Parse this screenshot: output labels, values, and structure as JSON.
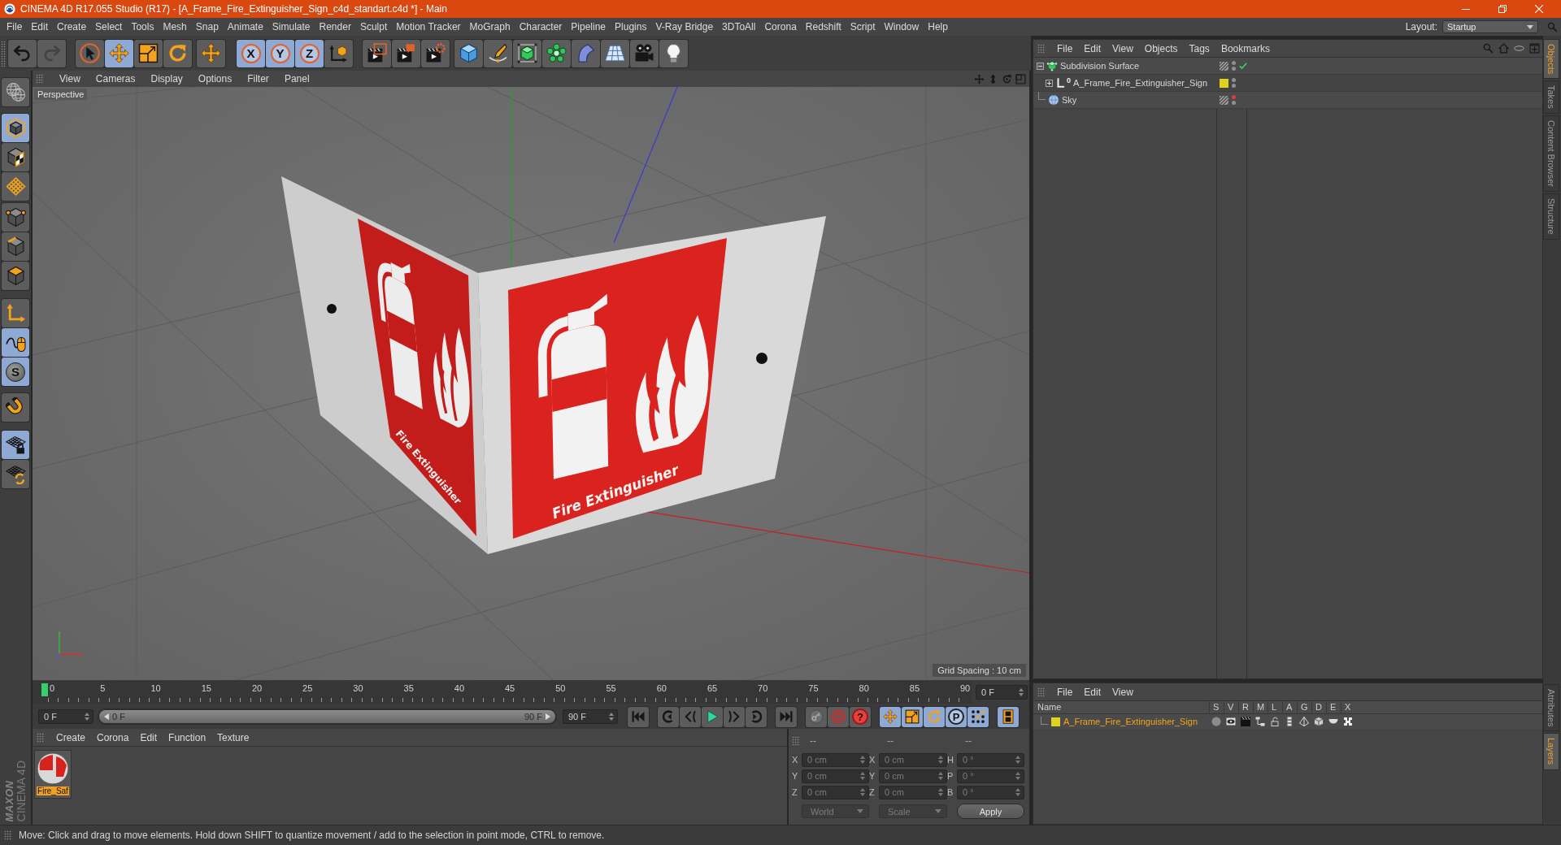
{
  "window": {
    "title": "CINEMA 4D R17.055 Studio (R17) - [A_Frame_Fire_Extinguisher_Sign_c4d_standart.c4d *] - Main"
  },
  "menu_bar": {
    "items": [
      "File",
      "Edit",
      "Create",
      "Select",
      "Tools",
      "Mesh",
      "Snap",
      "Animate",
      "Simulate",
      "Render",
      "Sculpt",
      "Motion Tracker",
      "MoGraph",
      "Character",
      "Pipeline",
      "Plugins",
      "V-Ray Bridge",
      "3DToAll",
      "Corona",
      "Redshift",
      "Script",
      "Window",
      "Help"
    ],
    "layout": {
      "label": "Layout:",
      "value": "Startup"
    }
  },
  "toolbar": {
    "history": [
      {
        "kind": "undo",
        "disabled": false
      },
      {
        "kind": "redo",
        "disabled": true
      }
    ],
    "groups": [
      [
        {
          "kind": "select",
          "selected": false
        },
        {
          "kind": "move",
          "selected": true
        },
        {
          "kind": "scale",
          "selected": false
        },
        {
          "kind": "rotate",
          "selected": false
        }
      ],
      [
        {
          "kind": "move",
          "selected": false
        }
      ],
      [
        {
          "kind": "axis",
          "label": "X",
          "selected": true
        },
        {
          "kind": "axis",
          "label": "Y",
          "selected": true
        },
        {
          "kind": "axis",
          "label": "Z",
          "selected": true
        },
        {
          "kind": "coords",
          "selected": false
        }
      ],
      [
        {
          "kind": "render-view",
          "selected": false
        },
        {
          "kind": "render-picture",
          "selected": false
        },
        {
          "kind": "render-settings",
          "selected": false
        }
      ],
      [
        {
          "kind": "cube",
          "selected": false
        },
        {
          "kind": "pen",
          "selected": false
        },
        {
          "kind": "subdivision",
          "selected": false
        },
        {
          "kind": "cloner",
          "selected": false
        },
        {
          "kind": "deformer",
          "selected": false
        },
        {
          "kind": "floor",
          "selected": false
        },
        {
          "kind": "camera",
          "selected": false
        },
        {
          "kind": "light",
          "selected": false
        }
      ]
    ]
  },
  "left_toolbar": {
    "groups": [
      [
        {
          "kind": "globe",
          "selected": false
        }
      ],
      [
        {
          "kind": "model",
          "selected": true
        },
        {
          "kind": "texture",
          "selected": false
        },
        {
          "kind": "workplane",
          "selected": false
        }
      ],
      [
        {
          "kind": "points",
          "selected": false
        },
        {
          "kind": "edges",
          "selected": false
        },
        {
          "kind": "polygons",
          "selected": false
        }
      ],
      [
        {
          "kind": "axis-mode",
          "selected": false
        },
        {
          "kind": "tweak",
          "selected": true
        },
        {
          "kind": "soft",
          "label": "S",
          "selected": true
        }
      ],
      [
        {
          "kind": "snap",
          "selected": false
        }
      ],
      [
        {
          "kind": "lock",
          "selected": true
        },
        {
          "kind": "sync",
          "selected": false
        }
      ]
    ],
    "logo": [
      "MAXON",
      "CINEMA 4D"
    ]
  },
  "viewport": {
    "menu": [
      "View",
      "Cameras",
      "Display",
      "Options",
      "Filter",
      "Panel"
    ],
    "camera": "Perspective",
    "grid_spacing": "Grid Spacing : 10 cm",
    "sign_labels": [
      "Fire Extinguisher",
      "Fire Extinguisher"
    ]
  },
  "timeline": {
    "labels": [
      "0",
      "5",
      "10",
      "15",
      "20",
      "25",
      "30",
      "35",
      "40",
      "45",
      "50",
      "55",
      "60",
      "65",
      "70",
      "75",
      "80",
      "85",
      "90"
    ],
    "playhead": {
      "level": 0
    },
    "current": "0 F"
  },
  "frame_range": {
    "start": "0 F",
    "range_start": "0 F",
    "range_end": "90 F",
    "level": 1,
    "end": "90 F"
  },
  "playback": [
    [
      {
        "kind": "to-start"
      }
    ],
    [
      {
        "kind": "prev-key"
      },
      {
        "kind": "prev-frame"
      },
      {
        "kind": "play"
      },
      {
        "kind": "next-frame"
      },
      {
        "kind": "next-key"
      }
    ],
    [
      {
        "kind": "to-end"
      }
    ]
  ],
  "anim_tools": [
    [
      {
        "kind": "key",
        "selected": false
      },
      {
        "kind": "autokey",
        "selected": false
      },
      {
        "kind": "help",
        "label": "?",
        "selected": false
      }
    ],
    [
      {
        "kind": "move",
        "selected": true
      },
      {
        "kind": "scale",
        "selected": true
      },
      {
        "kind": "rotate",
        "selected": true
      },
      {
        "kind": "param",
        "label": "P",
        "selected": true
      },
      {
        "kind": "dots",
        "selected": true
      }
    ],
    [
      {
        "kind": "film",
        "selected": true
      }
    ]
  ],
  "materials": {
    "menu": [
      "Create",
      "Corona",
      "Edit",
      "Function",
      "Texture"
    ],
    "items": [
      {
        "name": "Fire_Saf",
        "selected": true
      }
    ]
  },
  "coordinates": {
    "headers": [
      "--",
      "--",
      "--"
    ],
    "disabled": true,
    "rows": [
      {
        "label": "X",
        "position": "0 cm",
        "size_label": "X",
        "size": "0 cm",
        "rotation_label": "H",
        "rotation": "0 °"
      },
      {
        "label": "Y",
        "position": "0 cm",
        "size_label": "Y",
        "size": "0 cm",
        "rotation_label": "P",
        "rotation": "0 °"
      },
      {
        "label": "Z",
        "position": "0 cm",
        "size_label": "Z",
        "size": "0 cm",
        "rotation_label": "B",
        "rotation": "0 °"
      }
    ],
    "mode": "World",
    "size_mode": "Scale",
    "apply": "Apply"
  },
  "objects": {
    "menu": [
      "File",
      "Edit",
      "View",
      "Objects",
      "Tags",
      "Bookmarks"
    ],
    "tree": [
      {
        "name": "Subdivision Surface",
        "kind": "subdivision",
        "expanded": true,
        "selected": false,
        "editor_off": false,
        "render_off": false,
        "check": true,
        "children": [
          {
            "name": "A_Frame_Fire_Extinguisher_Sign",
            "kind": "null",
            "glyph": "0",
            "expanded": false,
            "selected": false,
            "color": "#e0d21e",
            "editor_off": false,
            "render_off": false,
            "check": false
          }
        ]
      },
      {
        "name": "Sky",
        "kind": "sky",
        "selected": false,
        "editor_off": true,
        "render_off": false,
        "check": false
      }
    ]
  },
  "side_tabs": {
    "top": [
      {
        "label": "Objects",
        "selected": true
      },
      {
        "label": "Takes",
        "selected": false
      },
      {
        "label": "Content Browser",
        "selected": false
      },
      {
        "label": "Structure",
        "selected": false
      }
    ],
    "bottom": [
      {
        "label": "Attributes",
        "selected": false
      },
      {
        "label": "Layers",
        "selected": true
      }
    ]
  },
  "layers": {
    "menu": [
      "File",
      "Edit",
      "View"
    ],
    "columns": [
      "Name",
      "S",
      "V",
      "R",
      "M",
      "L",
      "A",
      "G",
      "D",
      "E",
      "X"
    ],
    "rows": [
      {
        "name": "A_Frame_Fire_Extinguisher_Sign",
        "color": "#e0d21e",
        "selected": true
      }
    ]
  },
  "status_bar": {
    "text": "Move: Click and drag to move elements. Hold down SHIFT to quantize movement / add to the selection in point mode, CTRL to remove."
  }
}
